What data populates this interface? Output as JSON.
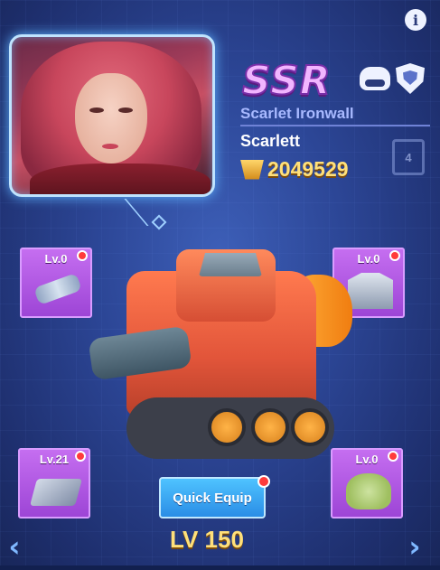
{
  "header": {
    "info_icon": "info-icon"
  },
  "hero": {
    "rarity": "SSR",
    "title": "Scarlet Ironwall",
    "name": "Scarlett",
    "power": "2049529",
    "power_icon": "power-crest-icon",
    "class_icons": [
      "tank-class-icon",
      "shield-class-icon"
    ],
    "rank_badge": "4"
  },
  "slots": [
    {
      "level": "Lv.0",
      "item": "barrel-icon",
      "has_alert": true
    },
    {
      "level": "Lv.0",
      "item": "armor-plate-icon",
      "has_alert": true
    },
    {
      "level": "Lv.21",
      "item": "chip-icon",
      "has_alert": true
    },
    {
      "level": "Lv.0",
      "item": "tree-emblem-icon",
      "has_alert": true
    }
  ],
  "actions": {
    "quick_equip": "Quick Equip"
  },
  "vehicle": {
    "level": "LV 150"
  },
  "nav": {
    "prev": "‹",
    "next": "›"
  },
  "colors": {
    "rarity": "#f1b5ff",
    "power": "#ffe07a",
    "slot_bg": "#b45be6",
    "button": "#3aa7f2",
    "alert": "#ff3b3b"
  }
}
